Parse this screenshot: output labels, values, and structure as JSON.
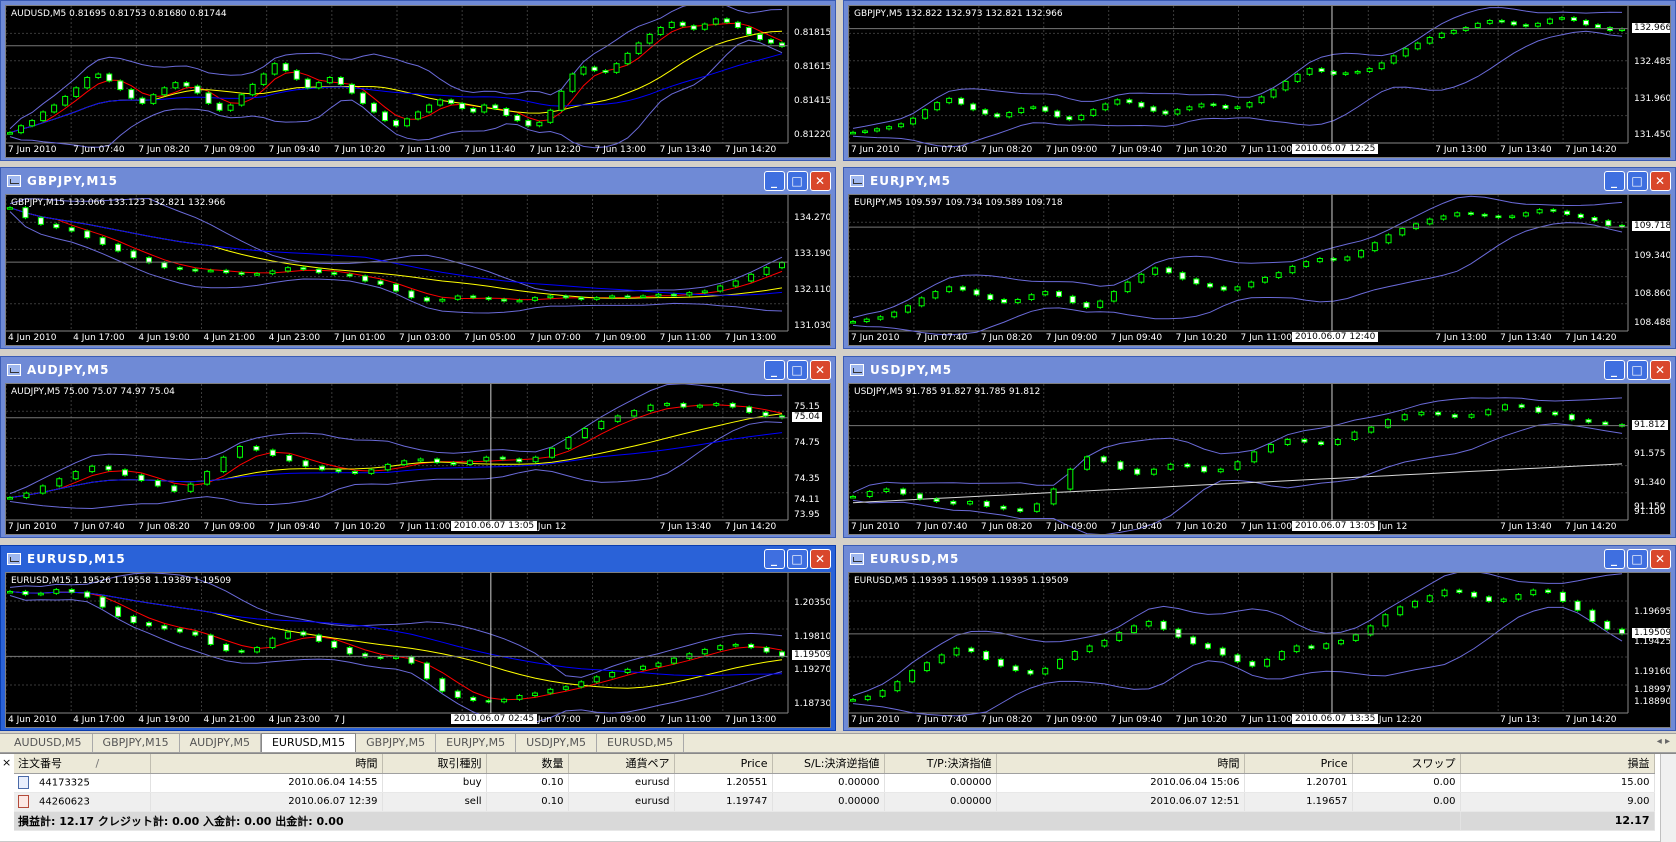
{
  "windows": [
    {
      "id": "w1",
      "title": "",
      "has_titlebar": false,
      "active": false,
      "ohlc": "AUDUSD,M5  0.81695 0.81753 0.81680 0.81744",
      "x_labels": [
        "7 Jun 2010",
        "7 Jun 07:40",
        "7 Jun 08:20",
        "7 Jun 09:00",
        "7 Jun 09:40",
        "7 Jun 10:20",
        "7 Jun 11:00",
        "7 Jun 11:40",
        "7 Jun 12:20",
        "7 Jun 13:00",
        "7 Jun 13:40",
        "7 Jun 14:20"
      ],
      "y_labels": [
        "0.81815",
        "0.81615",
        "0.81415",
        "0.81220"
      ],
      "price_tag": "0.81744",
      "cursor_label": "",
      "series": [
        0.8124,
        0.8128,
        0.8131,
        0.8136,
        0.814,
        0.8145,
        0.815,
        0.8156,
        0.8158,
        0.8154,
        0.8149,
        0.8144,
        0.8141,
        0.8146,
        0.815,
        0.8153,
        0.8151,
        0.8147,
        0.8141,
        0.8137,
        0.814,
        0.8146,
        0.8152,
        0.8158,
        0.8164,
        0.816,
        0.8155,
        0.815,
        0.8153,
        0.8156,
        0.8152,
        0.8147,
        0.8141,
        0.8136,
        0.8131,
        0.8128,
        0.8132,
        0.8136,
        0.814,
        0.8143,
        0.8141,
        0.8138,
        0.8136,
        0.814,
        0.8138,
        0.8134,
        0.8131,
        0.8128,
        0.813,
        0.8137,
        0.8148,
        0.8158,
        0.8162,
        0.816,
        0.8159,
        0.8164,
        0.817,
        0.8176,
        0.8181,
        0.8185,
        0.8188,
        0.8186,
        0.8184,
        0.8187,
        0.819,
        0.8188,
        0.8185,
        0.8181,
        0.8178,
        0.8176,
        0.8174
      ],
      "ylim": [
        0.8118,
        0.8194
      ]
    },
    {
      "id": "w2",
      "title": "",
      "has_titlebar": false,
      "active": false,
      "ohlc": "GBPJPY,M5  132.822 132.973 132.821 132.966",
      "x_labels": [
        "7 Jun 2010",
        "7 Jun 07:40",
        "7 Jun 08:20",
        "7 Jun 09:00",
        "7 Jun 09:40",
        "7 Jun 10:20",
        "7 Jun 11:00",
        "7 Jun 11",
        "",
        "7 Jun 13:00",
        "7 Jun 13:40",
        "7 Jun 14:20"
      ],
      "y_labels": [
        "132.966",
        "132.485",
        "131.960",
        "131.450"
      ],
      "price_tag": "132.966",
      "cursor_label": "2010.06.07 12:25",
      "series": [
        131.5,
        131.52,
        131.55,
        131.58,
        131.62,
        131.7,
        131.82,
        131.92,
        131.98,
        131.9,
        131.82,
        131.76,
        131.72,
        131.78,
        131.84,
        131.86,
        131.8,
        131.72,
        131.68,
        131.74,
        131.82,
        131.9,
        131.96,
        131.92,
        131.86,
        131.8,
        131.76,
        131.82,
        131.86,
        131.9,
        131.88,
        131.84,
        131.86,
        131.92,
        132.0,
        132.1,
        132.22,
        132.32,
        132.4,
        132.36,
        132.32,
        132.34,
        132.36,
        132.4,
        132.48,
        132.58,
        132.68,
        132.76,
        132.84,
        132.9,
        132.94,
        132.98,
        133.04,
        133.08,
        133.06,
        133.02,
        133.0,
        133.04,
        133.1,
        133.12,
        133.08,
        133.02,
        132.98,
        132.94,
        132.96
      ],
      "ylim": [
        131.35,
        133.2
      ]
    },
    {
      "id": "w3",
      "title": "GBPJPY,M15",
      "has_titlebar": true,
      "active": false,
      "ohlc": "GBPJPY,M15  133.066 133.123 132.821 132.966",
      "x_labels": [
        "4 Jun 2010",
        "4 Jun 17:00",
        "4 Jun 19:00",
        "4 Jun 21:00",
        "4 Jun 23:00",
        "7 Jun 01:00",
        "7 Jun 03:00",
        "7 Jun 05:00",
        "7 Jun 07:00",
        "7 Jun 09:00",
        "7 Jun 11:00",
        "7 Jun 13:00"
      ],
      "y_labels": [
        "134.270",
        "133.190",
        "132.110",
        "131.030"
      ],
      "price_tag": "132.966",
      "cursor_label": "",
      "series": [
        134.6,
        134.3,
        134.1,
        134.0,
        133.9,
        133.7,
        133.5,
        133.3,
        133.1,
        132.95,
        132.8,
        132.75,
        132.7,
        132.72,
        132.65,
        132.6,
        132.62,
        132.7,
        132.8,
        132.75,
        132.65,
        132.6,
        132.55,
        132.4,
        132.3,
        132.1,
        131.9,
        131.8,
        131.85,
        131.95,
        131.9,
        131.85,
        131.8,
        131.82,
        131.9,
        131.95,
        131.9,
        131.85,
        131.9,
        131.95,
        131.92,
        131.95,
        132.0,
        131.98,
        132.05,
        132.1,
        132.25,
        132.4,
        132.6,
        132.8,
        132.95
      ],
      "ylim": [
        130.9,
        134.8
      ]
    },
    {
      "id": "w4",
      "title": "EURJPY,M5",
      "has_titlebar": true,
      "active": false,
      "ohlc": "EURJPY,M5  109.597 109.734 109.589 109.718",
      "x_labels": [
        "7 Jun 2010",
        "7 Jun 07:40",
        "7 Jun 08:20",
        "7 Jun 09:00",
        "7 Jun 09:40",
        "7 Jun 10:20",
        "7 Jun 11:00",
        "7 Jun 11:40",
        "",
        "7 Jun 13:00",
        "7 Jun 13:40",
        "7 Jun 14:20"
      ],
      "y_labels": [
        "109.718",
        "109.340",
        "108.860",
        "108.488"
      ],
      "price_tag": "109.718",
      "cursor_label": "2010.06.07 12:40",
      "series": [
        108.52,
        108.55,
        108.58,
        108.64,
        108.72,
        108.82,
        108.9,
        108.96,
        108.92,
        108.86,
        108.8,
        108.76,
        108.8,
        108.86,
        108.9,
        108.84,
        108.76,
        108.7,
        108.78,
        108.9,
        109.02,
        109.12,
        109.2,
        109.14,
        109.06,
        109.0,
        108.96,
        108.92,
        108.96,
        109.02,
        109.08,
        109.14,
        109.22,
        109.28,
        109.32,
        109.3,
        109.34,
        109.42,
        109.52,
        109.62,
        109.7,
        109.76,
        109.82,
        109.86,
        109.9,
        109.88,
        109.86,
        109.84,
        109.86,
        109.9,
        109.94,
        109.92,
        109.88,
        109.84,
        109.8,
        109.74,
        109.72
      ],
      "ylim": [
        108.4,
        110.05
      ]
    },
    {
      "id": "w5",
      "title": "AUDJPY,M5",
      "has_titlebar": true,
      "active": false,
      "ohlc": "AUDJPY,M5  75.00 75.07 74.97 75.04",
      "x_labels": [
        "7 Jun 2010",
        "7 Jun 07:40",
        "7 Jun 08:20",
        "7 Jun 09:00",
        "7 Jun 09:40",
        "7 Jun 10:20",
        "7 Jun 11:00",
        "7 Jun 11:40",
        "7 Jun 12",
        "",
        "7 Jun 13:40",
        "7 Jun 14:20"
      ],
      "y_labels": [
        "75.15",
        "75.04",
        "74.75",
        "74.35",
        "74.11",
        "73.95"
      ],
      "price_tag": "75.04",
      "cursor_label": "2010.06.07 13:05",
      "series": [
        74.15,
        74.2,
        74.28,
        74.36,
        74.44,
        74.5,
        74.46,
        74.4,
        74.34,
        74.28,
        74.22,
        74.3,
        74.44,
        74.6,
        74.72,
        74.68,
        74.62,
        74.56,
        74.5,
        74.46,
        74.44,
        74.42,
        74.46,
        74.52,
        74.56,
        74.58,
        74.54,
        74.52,
        74.56,
        74.6,
        74.58,
        74.55,
        74.6,
        74.7,
        74.82,
        74.92,
        75.0,
        75.06,
        75.12,
        75.18,
        75.2,
        75.16,
        75.18,
        75.2,
        75.16,
        75.1,
        75.06,
        75.04
      ],
      "ylim": [
        73.9,
        75.35
      ]
    },
    {
      "id": "w6",
      "title": "USDJPY,M5",
      "has_titlebar": true,
      "active": false,
      "ohlc": "USDJPY,M5  91.785 91.827 91.785 91.812",
      "x_labels": [
        "7 Jun 2010",
        "7 Jun 07:40",
        "7 Jun 08:20",
        "7 Jun 09:00",
        "7 Jun 09:40",
        "7 Jun 10:20",
        "7 Jun 11:00",
        "7 Jun 11:40",
        "7 Jun 12",
        "",
        "7 Jun 13:40",
        "7 Jun 14:20"
      ],
      "y_labels": [
        "91.812",
        "91.575",
        "91.340",
        "91.150",
        "91.105"
      ],
      "price_tag": "91.812",
      "cursor_label": "2010.06.07 13:05",
      "series": [
        91.24,
        91.28,
        91.3,
        91.26,
        91.22,
        91.2,
        91.18,
        91.2,
        91.16,
        91.14,
        91.12,
        91.18,
        91.3,
        91.46,
        91.56,
        91.52,
        91.46,
        91.42,
        91.46,
        91.5,
        91.48,
        91.44,
        91.46,
        91.52,
        91.6,
        91.66,
        91.7,
        91.68,
        91.66,
        91.7,
        91.76,
        91.8,
        91.86,
        91.9,
        91.92,
        91.9,
        91.88,
        91.9,
        91.94,
        91.98,
        91.96,
        91.92,
        91.9,
        91.86,
        91.84,
        91.82,
        91.81
      ],
      "ylim": [
        91.05,
        92.1
      ]
    },
    {
      "id": "w7",
      "title": "EURUSD,M15",
      "has_titlebar": true,
      "active": true,
      "ohlc": "EURUSD,M15  1.19526 1.19558 1.19389 1.19509",
      "x_labels": [
        "4 Jun 2010",
        "4 Jun 17:00",
        "4 Jun 19:00",
        "4 Jun 21:00",
        "4 Jun 23:00",
        "7 J",
        "",
        "7 Jun 05:00",
        "7 Jun 07:00",
        "7 Jun 09:00",
        "7 Jun 11:00",
        "7 Jun 13:00"
      ],
      "y_labels": [
        "1.20350",
        "1.19810",
        "1.19509",
        "1.19270",
        "1.18730"
      ],
      "price_tag": "1.19509",
      "cursor_label": "2010.06.07 02:45",
      "series": [
        1.2055,
        1.205,
        1.2052,
        1.2058,
        1.2054,
        1.2046,
        1.203,
        1.2015,
        1.2005,
        1.2,
        1.1995,
        1.199,
        1.1985,
        1.197,
        1.196,
        1.1958,
        1.1965,
        1.198,
        1.199,
        1.1985,
        1.1975,
        1.1965,
        1.1955,
        1.195,
        1.1948,
        1.195,
        1.194,
        1.1915,
        1.1895,
        1.1885,
        1.188,
        1.1878,
        1.1882,
        1.1888,
        1.1892,
        1.1898,
        1.1902,
        1.191,
        1.1918,
        1.1925,
        1.193,
        1.1935,
        1.194,
        1.1948,
        1.1955,
        1.1962,
        1.1968,
        1.197,
        1.1965,
        1.1958,
        1.1951
      ],
      "ylim": [
        1.186,
        1.2075
      ]
    },
    {
      "id": "w8",
      "title": "EURUSD,M5",
      "has_titlebar": true,
      "active": false,
      "ohlc": "EURUSD,M5  1.19395 1.19509 1.19395 1.19509",
      "x_labels": [
        "7 Jun 2010",
        "7 Jun 07:40",
        "7 Jun 08:20",
        "7 Jun 09:00",
        "7 Jun 09:40",
        "7 Jun 10:20",
        "7 Jun 11:00",
        "7 Jun 11:40",
        "7 Jun 12:20",
        "",
        "7 Jun 13:",
        "7 Jun 14:20"
      ],
      "y_labels": [
        "1.19695",
        "1.19509",
        "1.19425",
        "1.19160",
        "1.18997",
        "1.18890"
      ],
      "price_tag": "1.19509",
      "cursor_label": "2010.06.07 13:35",
      "series": [
        1.1892,
        1.1895,
        1.19,
        1.1908,
        1.1918,
        1.1925,
        1.1932,
        1.1938,
        1.1935,
        1.1928,
        1.1922,
        1.1918,
        1.1915,
        1.192,
        1.1928,
        1.1935,
        1.194,
        1.1945,
        1.1952,
        1.1958,
        1.1962,
        1.1955,
        1.1948,
        1.1942,
        1.1938,
        1.1932,
        1.1926,
        1.1922,
        1.1928,
        1.1935,
        1.194,
        1.1938,
        1.1942,
        1.1945,
        1.195,
        1.1958,
        1.1968,
        1.1975,
        1.198,
        1.1985,
        1.199,
        1.1988,
        1.1984,
        1.198,
        1.1982,
        1.1986,
        1.199,
        1.1988,
        1.198,
        1.1972,
        1.1962,
        1.1955,
        1.1951
      ],
      "ylim": [
        1.188,
        1.2
      ]
    }
  ],
  "tabs": [
    "AUDUSD,M5",
    "GBPJPY,M15",
    "AUDJPY,M5",
    "EURUSD,M15",
    "GBPJPY,M5",
    "EURJPY,M5",
    "USDJPY,M5",
    "EURUSD,M5"
  ],
  "selected_tab": 3,
  "tab_nav": "◂ ▸",
  "terminal": {
    "columns": [
      "注文番号",
      "時間",
      "取引種別",
      "数量",
      "通貨ペア",
      "Price",
      "S/L:決済逆指値",
      "T/P:決済指値",
      "時間",
      "Price",
      "スワップ",
      "損益"
    ],
    "sort_marker": "/",
    "rows": [
      {
        "type": "buy",
        "cells": [
          "44173325",
          "2010.06.04 14:55",
          "buy",
          "0.10",
          "eurusd",
          "1.20551",
          "0.00000",
          "0.00000",
          "2010.06.04 15:06",
          "1.20701",
          "0.00",
          "15.00"
        ]
      },
      {
        "type": "sell",
        "cells": [
          "44260623",
          "2010.06.07 12:39",
          "sell",
          "0.10",
          "eurusd",
          "1.19747",
          "0.00000",
          "0.00000",
          "2010.06.07 12:51",
          "1.19657",
          "0.00",
          "9.00"
        ]
      }
    ],
    "total_label": "損益計: 12.17  クレジット計: 0.00  入金計: 0.00  出金計: 0.00",
    "total_value": "12.17",
    "close_glyph": "×"
  },
  "colors": {
    "candle": "#00ff00",
    "bb": "#6a6ad8",
    "ma_fast": "#ff0000",
    "ma_slow": "#ffff00",
    "ma_long": "#0000ff",
    "grid": "#3a3a3a",
    "white_line": "#d8d8d8"
  }
}
